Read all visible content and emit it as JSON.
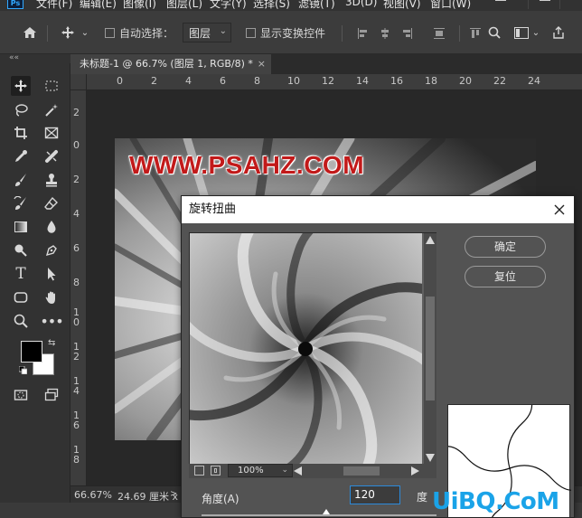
{
  "menu": {
    "items": [
      "文件(F)",
      "编辑(E)",
      "图像(I)",
      "图层(L)",
      "文字(Y)",
      "选择(S)",
      "滤镜(T)",
      "3D(D)",
      "视图(V)",
      "窗口(W)"
    ]
  },
  "options_bar": {
    "auto_select_label": "自动选择：",
    "auto_select_value": "图层",
    "show_transform_label": "显示变换控件"
  },
  "document_tab": {
    "title": "未标题-1 @ 66.7% (图层 1, RGB/8) *",
    "close": "×"
  },
  "panel_collapse": "««",
  "rulers": {
    "horizontal": [
      "0",
      "2",
      "4",
      "6",
      "8",
      "10",
      "12",
      "14",
      "16",
      "18",
      "20",
      "22",
      "24"
    ],
    "vertical": [
      "2",
      "0",
      "2",
      "4",
      "6",
      "8",
      "1\n0",
      "1\n2",
      "1\n4",
      "1\n6",
      "1\n8"
    ]
  },
  "canvas": {
    "watermark_text": "WWW.PSAHZ.COM"
  },
  "status_bar": {
    "zoom": "66.67%",
    "size": "24.69 厘米 x"
  },
  "dialog": {
    "title": "旋转扭曲",
    "ok_label": "确定",
    "reset_label": "复位",
    "zoom_value": "100%",
    "angle_label": "角度(A)",
    "angle_value": "120",
    "angle_unit": "度"
  },
  "colors": {
    "foreground": "#000000",
    "background": "#ffffff",
    "ps_accent": "#31a8ff",
    "watermark_red": "#c21a1a",
    "input_focus": "#2b8adb"
  },
  "site_watermark": "UiBQ.CoM"
}
